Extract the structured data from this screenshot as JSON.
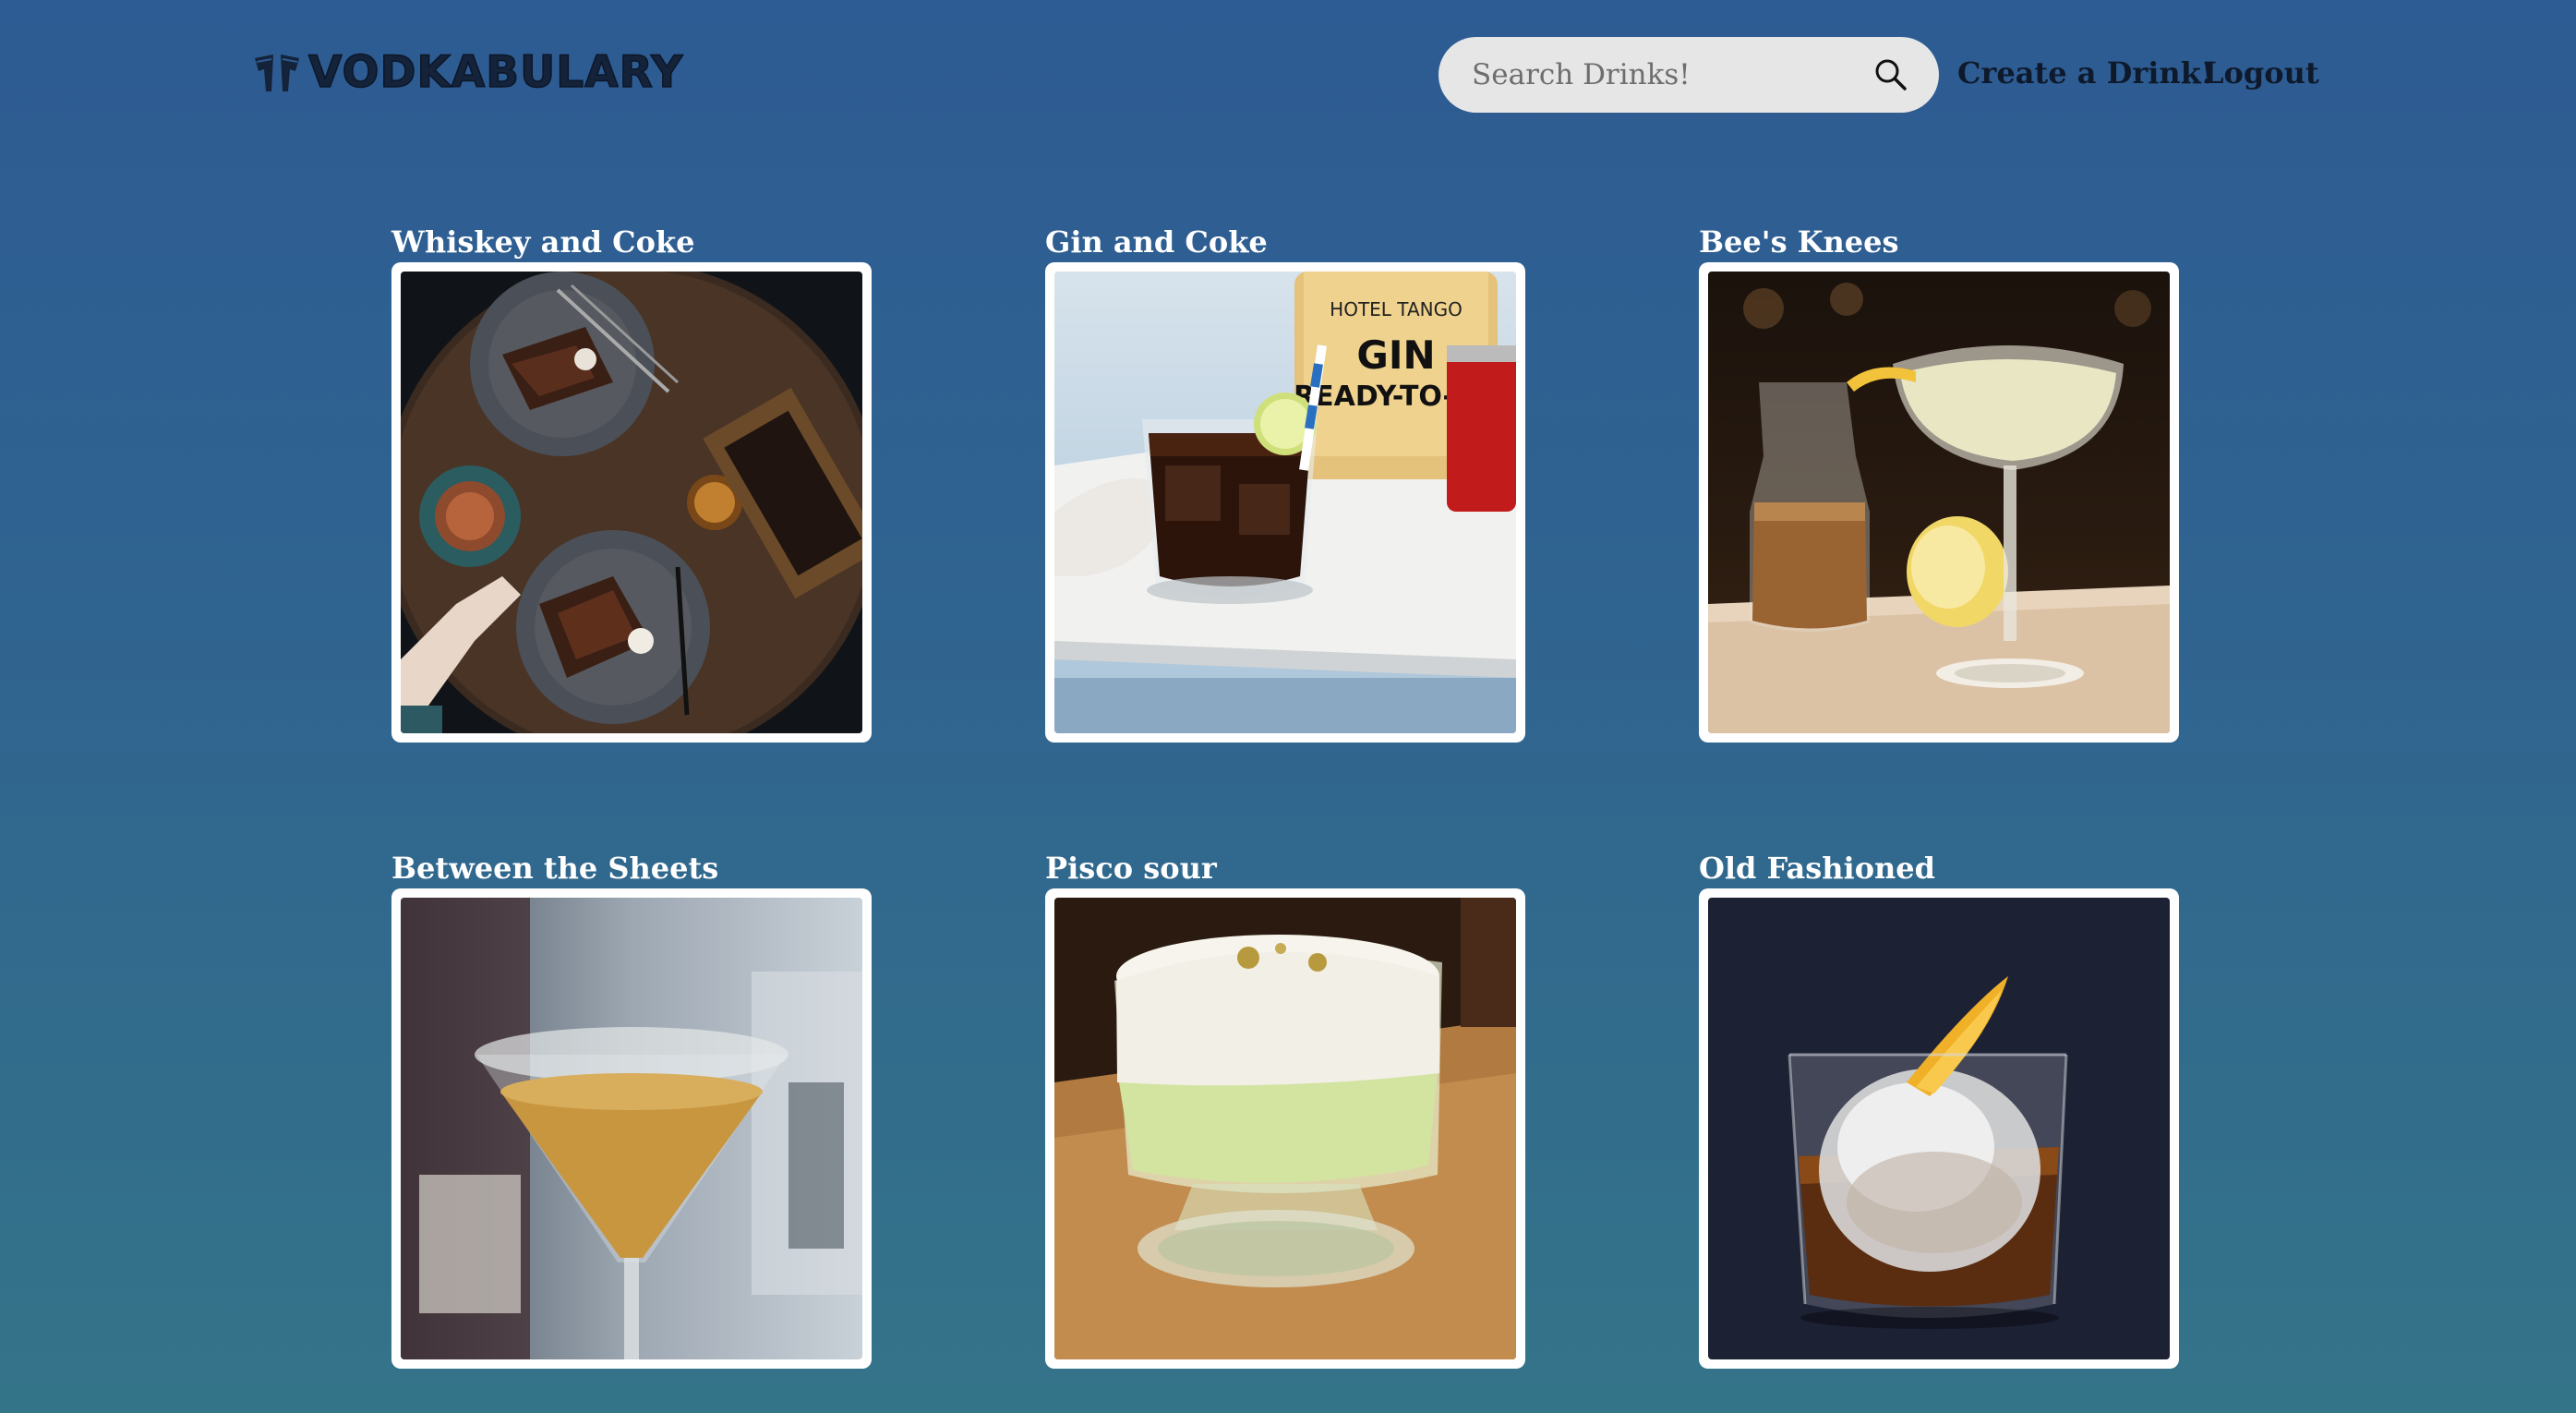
{
  "header": {
    "logo_text": "Vodkabulary",
    "logo_icon": "cocktail-glasses-icon",
    "search_placeholder": "Search Drinks!",
    "search_icon": "search-icon",
    "create_label": "Create a Drink!",
    "logout_label": "Logout"
  },
  "drinks": [
    {
      "title": "Whiskey and Coke"
    },
    {
      "title": "Gin and Coke",
      "bottle_label_top": "HOTEL TANGO",
      "bottle_label_main": "GIN",
      "bottle_label_sub": "READY-TO-DR"
    },
    {
      "title": "Bee's Knees"
    },
    {
      "title": "Between the Sheets"
    },
    {
      "title": "Pisco sour"
    },
    {
      "title": "Old Fashioned"
    }
  ],
  "colors": {
    "background_top": "#2d5b93",
    "background_bottom": "#347489",
    "card_border": "#ffffff",
    "title_text": "#ffffff",
    "nav_text": "#0e1a2c"
  }
}
